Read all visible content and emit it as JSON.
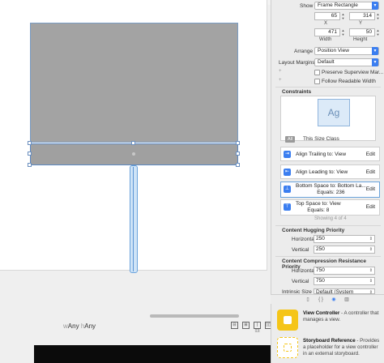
{
  "canvas": {
    "size_class": {
      "w": "w",
      "any1": "Any",
      "h": "h",
      "any2": "Any"
    },
    "tools": [
      "⊟",
      "⊞",
      "|◫|",
      "▯◫"
    ]
  },
  "inspector": {
    "show_label": "Show",
    "show_value": "Frame Rectangle",
    "x_value": "65",
    "y_value": "314",
    "x_label": "X",
    "y_label": "Y",
    "width_value": "471",
    "height_value": "50",
    "width_label": "Width",
    "height_label": "Height",
    "arrange_label": "Arrange",
    "arrange_value": "Position View",
    "layout_margins_label": "Layout Margins",
    "layout_margins_value": "Default",
    "preserve_superview": "Preserve Superview Mar...",
    "follow_readable": "Follow Readable Width",
    "constraints_title": "Constraints",
    "ag_text": "Ag",
    "all_tag": "All",
    "size_class_label": "This Size Class",
    "constraints": [
      {
        "line1": "Align Trailing to:",
        "line2": "View",
        "edit": "Edit"
      },
      {
        "line1": "Align Leading to:",
        "line2": "View",
        "edit": "Edit"
      },
      {
        "line1": "Bottom Space to:",
        "line2": "Bottom La...",
        "equals": "Equals:",
        "value": "236",
        "edit": "Edit"
      },
      {
        "line1": "Top Space to:",
        "line2": "View",
        "equals": "Equals:",
        "value": "8",
        "edit": "Edit"
      }
    ],
    "showing": "Showing 4 of 4",
    "hugging_title": "Content Hugging Priority",
    "hugging": [
      {
        "label": "Horizontal",
        "value": "250"
      },
      {
        "label": "Vertical",
        "value": "250"
      }
    ],
    "compression_title": "Content Compression Resistance Priority",
    "compression": [
      {
        "label": "Horizontal",
        "value": "750"
      },
      {
        "label": "Vertical",
        "value": "750"
      }
    ],
    "intrinsic_label": "Intrinsic Size",
    "intrinsic_value": "Default (System Defined)"
  },
  "library": {
    "tabs": [
      "▯",
      "{ }",
      "◉",
      "▥"
    ],
    "items": [
      {
        "title": "View Controller",
        "desc": " - A controller that manages a view."
      },
      {
        "title": "Storyboard Reference",
        "desc": " - Provides a placeholder for a view controller in an external storyboard."
      }
    ]
  }
}
